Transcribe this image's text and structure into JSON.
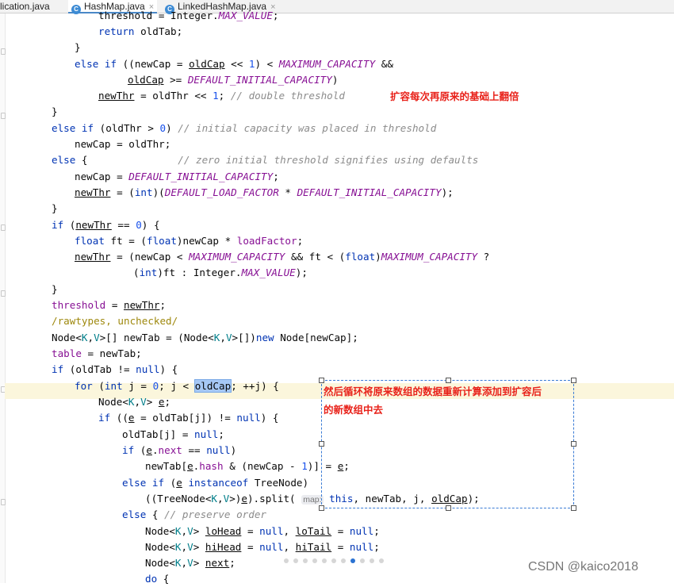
{
  "tabs": [
    {
      "label": "lication.java",
      "active": false
    },
    {
      "label": "HashMap.java",
      "active": true
    },
    {
      "label": "LinkedHashMap.java",
      "active": false
    }
  ],
  "code": {
    "lines": [
      {
        "segments": [
          {
            "t": "threshold = Integer."
          },
          {
            "t": "MAX_VALUE",
            "c": "cst"
          },
          {
            "t": ";"
          }
        ]
      },
      {
        "segments": [
          {
            "t": "return",
            "c": "kw"
          },
          {
            "t": " oldTab;"
          }
        ]
      },
      {
        "segments": [
          {
            "t": "}"
          }
        ]
      },
      {
        "segments": [
          {
            "t": "else if",
            "c": "kw"
          },
          {
            "t": " ((newCap = "
          },
          {
            "t": "oldCap",
            "c": "ul"
          },
          {
            "t": " << "
          },
          {
            "t": "1",
            "c": "num"
          },
          {
            "t": ") < "
          },
          {
            "t": "MAXIMUM_CAPACITY",
            "c": "cst"
          },
          {
            "t": " &&"
          }
        ]
      },
      {
        "segments": [
          {
            "t": "oldCap",
            "c": "ul"
          },
          {
            "t": " >= "
          },
          {
            "t": "DEFAULT_INITIAL_CAPACITY",
            "c": "cst"
          },
          {
            "t": ")"
          }
        ]
      },
      {
        "segments": [
          {
            "t": "newThr",
            "c": "ul"
          },
          {
            "t": " = oldThr << "
          },
          {
            "t": "1",
            "c": "num"
          },
          {
            "t": "; "
          },
          {
            "t": "// double threshold",
            "c": "cm"
          }
        ]
      },
      {
        "segments": [
          {
            "t": "}"
          }
        ]
      },
      {
        "segments": [
          {
            "t": "else if",
            "c": "kw"
          },
          {
            "t": " (oldThr > "
          },
          {
            "t": "0",
            "c": "num"
          },
          {
            "t": ") "
          },
          {
            "t": "// initial capacity was placed in threshold",
            "c": "cm"
          }
        ]
      },
      {
        "segments": [
          {
            "t": "newCap = oldThr;"
          }
        ]
      },
      {
        "segments": [
          {
            "t": "else",
            "c": "kw"
          },
          {
            "t": " {               "
          },
          {
            "t": "// zero initial threshold signifies using defaults",
            "c": "cm"
          }
        ]
      },
      {
        "segments": [
          {
            "t": "newCap = "
          },
          {
            "t": "DEFAULT_INITIAL_CAPACITY",
            "c": "cst"
          },
          {
            "t": ";"
          }
        ]
      },
      {
        "segments": [
          {
            "t": "newThr",
            "c": "ul"
          },
          {
            "t": " = ("
          },
          {
            "t": "int",
            "c": "kw"
          },
          {
            "t": ")("
          },
          {
            "t": "DEFAULT_LOAD_FACTOR",
            "c": "cst"
          },
          {
            "t": " * "
          },
          {
            "t": "DEFAULT_INITIAL_CAPACITY",
            "c": "cst"
          },
          {
            "t": ");"
          }
        ]
      },
      {
        "segments": [
          {
            "t": "}"
          }
        ]
      },
      {
        "segments": [
          {
            "t": "if",
            "c": "kw"
          },
          {
            "t": " ("
          },
          {
            "t": "newThr",
            "c": "ul"
          },
          {
            "t": " == "
          },
          {
            "t": "0",
            "c": "num"
          },
          {
            "t": ") {"
          }
        ]
      },
      {
        "segments": [
          {
            "t": "float",
            "c": "kw"
          },
          {
            "t": " ft = ("
          },
          {
            "t": "float",
            "c": "kw"
          },
          {
            "t": ")newCap * "
          },
          {
            "t": "loadFactor",
            "c": "fld"
          },
          {
            "t": ";"
          }
        ]
      },
      {
        "segments": [
          {
            "t": "newThr",
            "c": "ul"
          },
          {
            "t": " = (newCap < "
          },
          {
            "t": "MAXIMUM_CAPACITY",
            "c": "cst"
          },
          {
            "t": " && ft < ("
          },
          {
            "t": "float",
            "c": "kw"
          },
          {
            "t": ")"
          },
          {
            "t": "MAXIMUM_CAPACITY",
            "c": "cst"
          },
          {
            "t": " ?"
          }
        ]
      },
      {
        "segments": [
          {
            "t": "("
          },
          {
            "t": "int",
            "c": "kw"
          },
          {
            "t": ")ft : Integer."
          },
          {
            "t": "MAX_VALUE",
            "c": "cst"
          },
          {
            "t": ");"
          }
        ]
      },
      {
        "segments": [
          {
            "t": "}"
          }
        ]
      },
      {
        "segments": [
          {
            "t": "threshold",
            "c": "fld"
          },
          {
            "t": " = "
          },
          {
            "t": "newThr",
            "c": "ul"
          },
          {
            "t": ";"
          }
        ]
      },
      {
        "segments": [
          {
            "t": "/rawtypes, unchecked/",
            "c": "anno"
          }
        ]
      },
      {
        "segments": [
          {
            "t": "Node<"
          },
          {
            "t": "K",
            "c": "tp"
          },
          {
            "t": ","
          },
          {
            "t": "V",
            "c": "tp"
          },
          {
            "t": ">[] newTab = (Node<"
          },
          {
            "t": "K",
            "c": "tp"
          },
          {
            "t": ","
          },
          {
            "t": "V",
            "c": "tp"
          },
          {
            "t": ">[])"
          },
          {
            "t": "new",
            "c": "kw"
          },
          {
            "t": " Node[newCap];"
          }
        ]
      },
      {
        "segments": [
          {
            "t": "table",
            "c": "fld"
          },
          {
            "t": " = newTab;"
          }
        ]
      },
      {
        "segments": [
          {
            "t": "if",
            "c": "kw"
          },
          {
            "t": " (oldTab != "
          },
          {
            "t": "null",
            "c": "kw"
          },
          {
            "t": ") {"
          }
        ]
      },
      {
        "segments": [
          {
            "t": "for",
            "c": "kw"
          },
          {
            "t": " ("
          },
          {
            "t": "int",
            "c": "kw"
          },
          {
            "t": " j = "
          },
          {
            "t": "0",
            "c": "num"
          },
          {
            "t": "; j < "
          },
          {
            "t": "oldCap",
            "c": "sel"
          },
          {
            "t": "; ++j) {"
          }
        ]
      },
      {
        "segments": [
          {
            "t": "Node<"
          },
          {
            "t": "K",
            "c": "tp"
          },
          {
            "t": ","
          },
          {
            "t": "V",
            "c": "tp"
          },
          {
            "t": "> "
          },
          {
            "t": "e",
            "c": "ul"
          },
          {
            "t": ";"
          }
        ]
      },
      {
        "segments": [
          {
            "t": "if",
            "c": "kw"
          },
          {
            "t": " (("
          },
          {
            "t": "e",
            "c": "ul"
          },
          {
            "t": " = oldTab[j]) != "
          },
          {
            "t": "null",
            "c": "kw"
          },
          {
            "t": ") {"
          }
        ]
      },
      {
        "segments": [
          {
            "t": "oldTab[j] = "
          },
          {
            "t": "null",
            "c": "kw"
          },
          {
            "t": ";"
          }
        ]
      },
      {
        "segments": [
          {
            "t": "if",
            "c": "kw"
          },
          {
            "t": " ("
          },
          {
            "t": "e",
            "c": "ul"
          },
          {
            "t": "."
          },
          {
            "t": "next",
            "c": "fld"
          },
          {
            "t": " == "
          },
          {
            "t": "null",
            "c": "kw"
          },
          {
            "t": ")"
          }
        ]
      },
      {
        "segments": [
          {
            "t": "newTab["
          },
          {
            "t": "e",
            "c": "ul"
          },
          {
            "t": "."
          },
          {
            "t": "hash",
            "c": "fld"
          },
          {
            "t": " & (newCap - "
          },
          {
            "t": "1",
            "c": "num"
          },
          {
            "t": ")] = "
          },
          {
            "t": "e",
            "c": "ul"
          },
          {
            "t": ";"
          }
        ]
      },
      {
        "segments": [
          {
            "t": "else if",
            "c": "kw"
          },
          {
            "t": " ("
          },
          {
            "t": "e",
            "c": "ul"
          },
          {
            "t": " "
          },
          {
            "t": "instanceof",
            "c": "kw"
          },
          {
            "t": " TreeNode)"
          }
        ]
      },
      {
        "segments": [
          {
            "t": "((TreeNode<"
          },
          {
            "t": "K",
            "c": "tp"
          },
          {
            "t": ","
          },
          {
            "t": "V",
            "c": "tp"
          },
          {
            "t": ">)"
          },
          {
            "t": "e",
            "c": "ul"
          },
          {
            "t": ").split( "
          },
          {
            "t": "map:",
            "c": "hint"
          },
          {
            "t": " "
          },
          {
            "t": "this",
            "c": "kw"
          },
          {
            "t": ", newTab, j, "
          },
          {
            "t": "oldCap",
            "c": "ul"
          },
          {
            "t": ");"
          }
        ]
      },
      {
        "segments": [
          {
            "t": "else",
            "c": "kw"
          },
          {
            "t": " { "
          },
          {
            "t": "// preserve order",
            "c": "cm"
          }
        ]
      },
      {
        "segments": [
          {
            "t": "Node<"
          },
          {
            "t": "K",
            "c": "tp"
          },
          {
            "t": ","
          },
          {
            "t": "V",
            "c": "tp"
          },
          {
            "t": "> "
          },
          {
            "t": "loHead",
            "c": "ul"
          },
          {
            "t": " = "
          },
          {
            "t": "null",
            "c": "kw"
          },
          {
            "t": ", "
          },
          {
            "t": "loTail",
            "c": "ul"
          },
          {
            "t": " = "
          },
          {
            "t": "null",
            "c": "kw"
          },
          {
            "t": ";"
          }
        ]
      },
      {
        "segments": [
          {
            "t": "Node<"
          },
          {
            "t": "K",
            "c": "tp"
          },
          {
            "t": ","
          },
          {
            "t": "V",
            "c": "tp"
          },
          {
            "t": "> "
          },
          {
            "t": "hiHead",
            "c": "ul"
          },
          {
            "t": " = "
          },
          {
            "t": "null",
            "c": "kw"
          },
          {
            "t": ", "
          },
          {
            "t": "hiTail",
            "c": "ul"
          },
          {
            "t": " = "
          },
          {
            "t": "null",
            "c": "kw"
          },
          {
            "t": ";"
          }
        ]
      },
      {
        "segments": [
          {
            "t": "Node<"
          },
          {
            "t": "K",
            "c": "tp"
          },
          {
            "t": ","
          },
          {
            "t": "V",
            "c": "tp"
          },
          {
            "t": "> "
          },
          {
            "t": "next",
            "c": "ul"
          },
          {
            "t": ";"
          }
        ]
      },
      {
        "segments": [
          {
            "t": "do",
            "c": "kw"
          },
          {
            "t": " {"
          }
        ]
      }
    ]
  },
  "annotations": {
    "note1": "扩容每次再原来的基础上翻倍",
    "note2_line1": "然后循环将原来数组的数据重新计算添加到扩容后",
    "note2_line2": "的新数组中去"
  },
  "pager": {
    "count": 11,
    "active_index": 7
  },
  "watermark": "CSDN @kaico2018",
  "colors": {
    "keyword": "#0033b3",
    "constant": "#871094",
    "comment": "#8c8c8c",
    "annotation_text": "#e8221a",
    "selection": "#a6c8f5"
  }
}
